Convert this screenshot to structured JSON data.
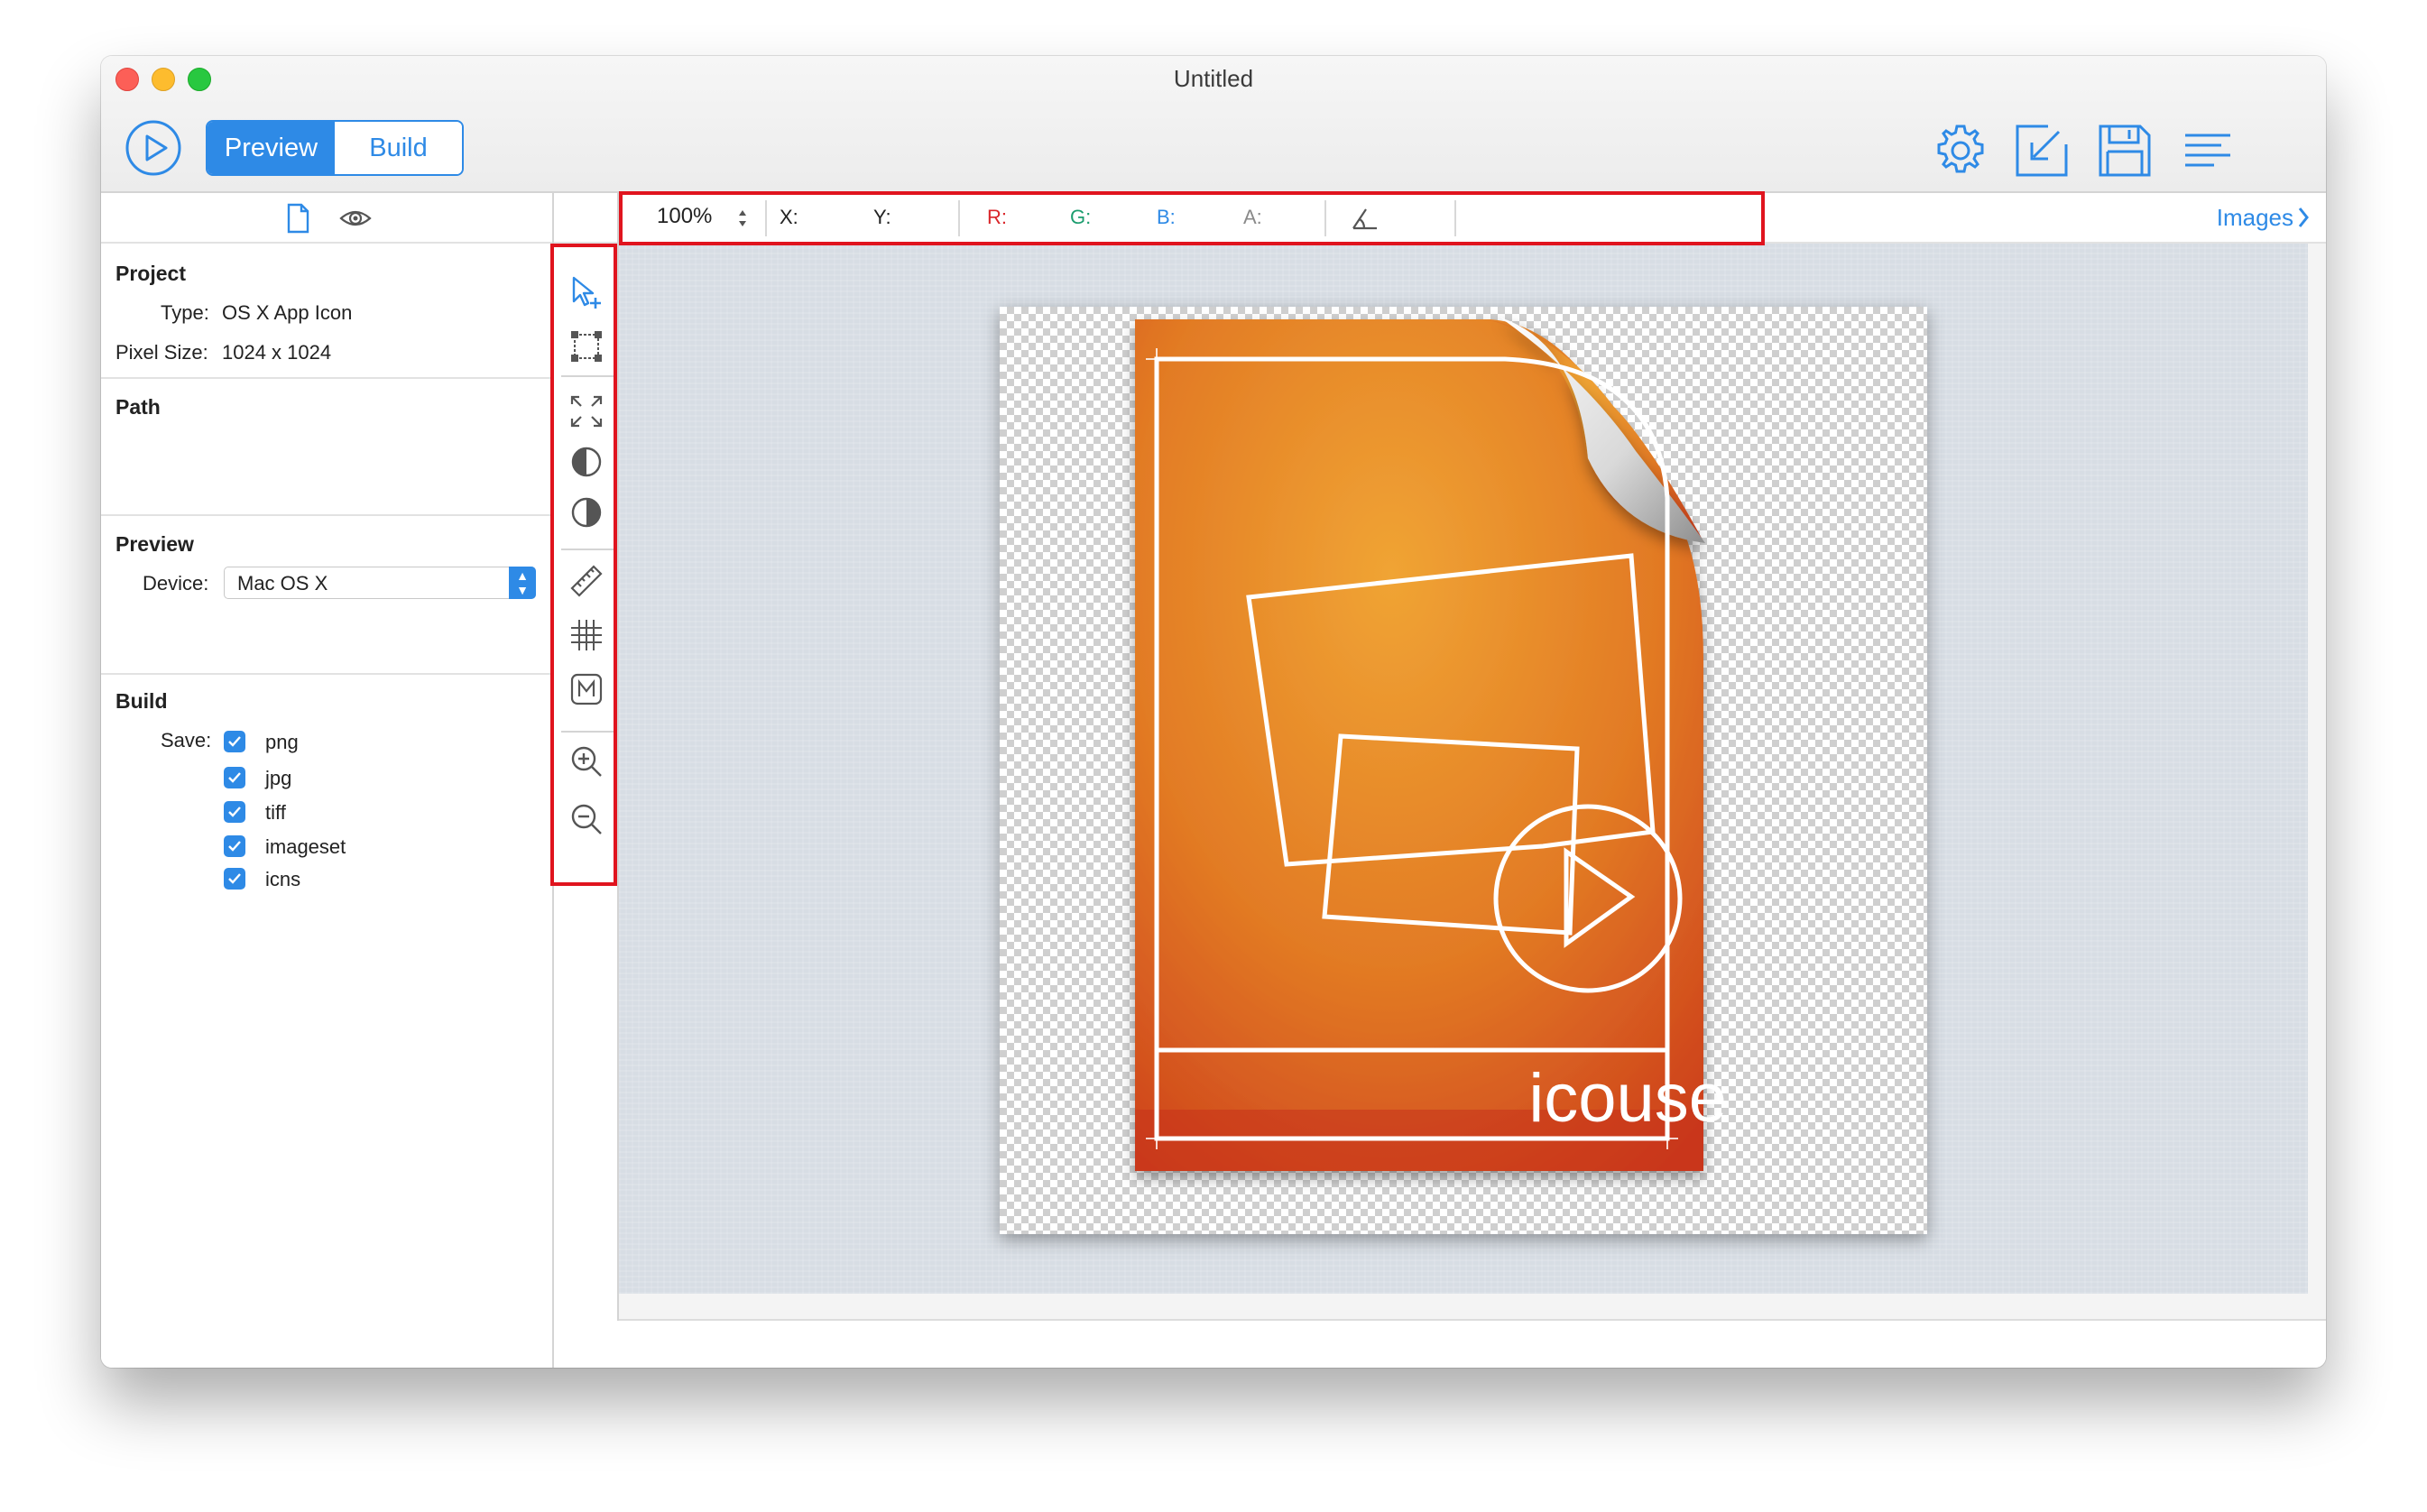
{
  "window": {
    "title": "Untitled"
  },
  "toolbar": {
    "run_icon": "play-circle-icon",
    "mode_tabs": [
      {
        "label": "Preview",
        "selected": true
      },
      {
        "label": "Build",
        "selected": false
      }
    ],
    "right_icons": [
      "gear-icon",
      "export-icon",
      "save-icon",
      "menu-lines-icon"
    ]
  },
  "sidebar": {
    "tabs": [
      "document-icon",
      "eye-icon"
    ],
    "project": {
      "heading": "Project",
      "type_label": "Type:",
      "type_value": "OS X App Icon",
      "size_label": "Pixel Size:",
      "size_value": "1024 x 1024"
    },
    "path": {
      "heading": "Path"
    },
    "preview": {
      "heading": "Preview",
      "device_label": "Device:",
      "device_value": "Mac OS X"
    },
    "build": {
      "heading": "Build",
      "save_label": "Save:",
      "formats": [
        {
          "label": "png",
          "checked": true
        },
        {
          "label": "jpg",
          "checked": true
        },
        {
          "label": "tiff",
          "checked": true
        },
        {
          "label": "imageset",
          "checked": true
        },
        {
          "label": "icns",
          "checked": true
        }
      ]
    }
  },
  "tools": [
    "select-add-icon",
    "bounding-box-icon",
    "fit-expand-icon",
    "contrast-left-icon",
    "contrast-right-icon",
    "ruler-icon",
    "grid-icon",
    "mask-m-icon",
    "zoom-in-icon",
    "zoom-out-icon"
  ],
  "infobar": {
    "zoom": "100%",
    "x_label": "X:",
    "y_label": "Y:",
    "r_label": "R:",
    "g_label": "G:",
    "b_label": "B:",
    "a_label": "A:",
    "angle_icon": "angle-icon",
    "images_link": "Images"
  },
  "canvas": {
    "icon_text": "icouse"
  },
  "colors": {
    "accent": "#2e8ae6",
    "highlight": "#e0141e",
    "r": "#d9262a",
    "g": "#1c9d6f",
    "b": "#2e8ae6",
    "a": "#8a8a8a"
  }
}
